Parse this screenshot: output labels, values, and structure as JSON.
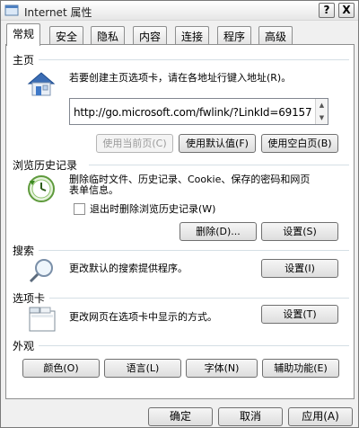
{
  "window": {
    "title": "Internet 属性",
    "help_label": "?",
    "close_label": "X"
  },
  "tabs": [
    "常规",
    "安全",
    "隐私",
    "内容",
    "连接",
    "程序",
    "高级"
  ],
  "home": {
    "section_title": "主页",
    "description": "若要创建主页选项卡，请在各地址行键入地址(R)。",
    "url": "http://go.microsoft.com/fwlink/?LinkId=69157",
    "use_current": "使用当前页(C)",
    "use_default": "使用默认值(F)",
    "use_blank": "使用空白页(B)"
  },
  "history": {
    "section_title": "浏览历史记录",
    "description_line1": "删除临时文件、历史记录、Cookie、保存的密码和网页",
    "description_line2": "表单信息。",
    "checkbox_label": "退出时删除浏览历史记录(W)",
    "delete_label": "删除(D)...",
    "settings_label": "设置(S)"
  },
  "search": {
    "section_title": "搜索",
    "description": "更改默认的搜索提供程序。",
    "settings_label": "设置(I)"
  },
  "tabs_section": {
    "section_title": "选项卡",
    "description": "更改网页在选项卡中显示的方式。",
    "settings_label": "设置(T)"
  },
  "appearance": {
    "section_title": "外观",
    "colors": "颜色(O)",
    "languages": "语言(L)",
    "fonts": "字体(N)",
    "accessibility": "辅助功能(E)"
  },
  "footer": {
    "ok": "确定",
    "cancel": "取消",
    "apply": "应用(A)"
  }
}
